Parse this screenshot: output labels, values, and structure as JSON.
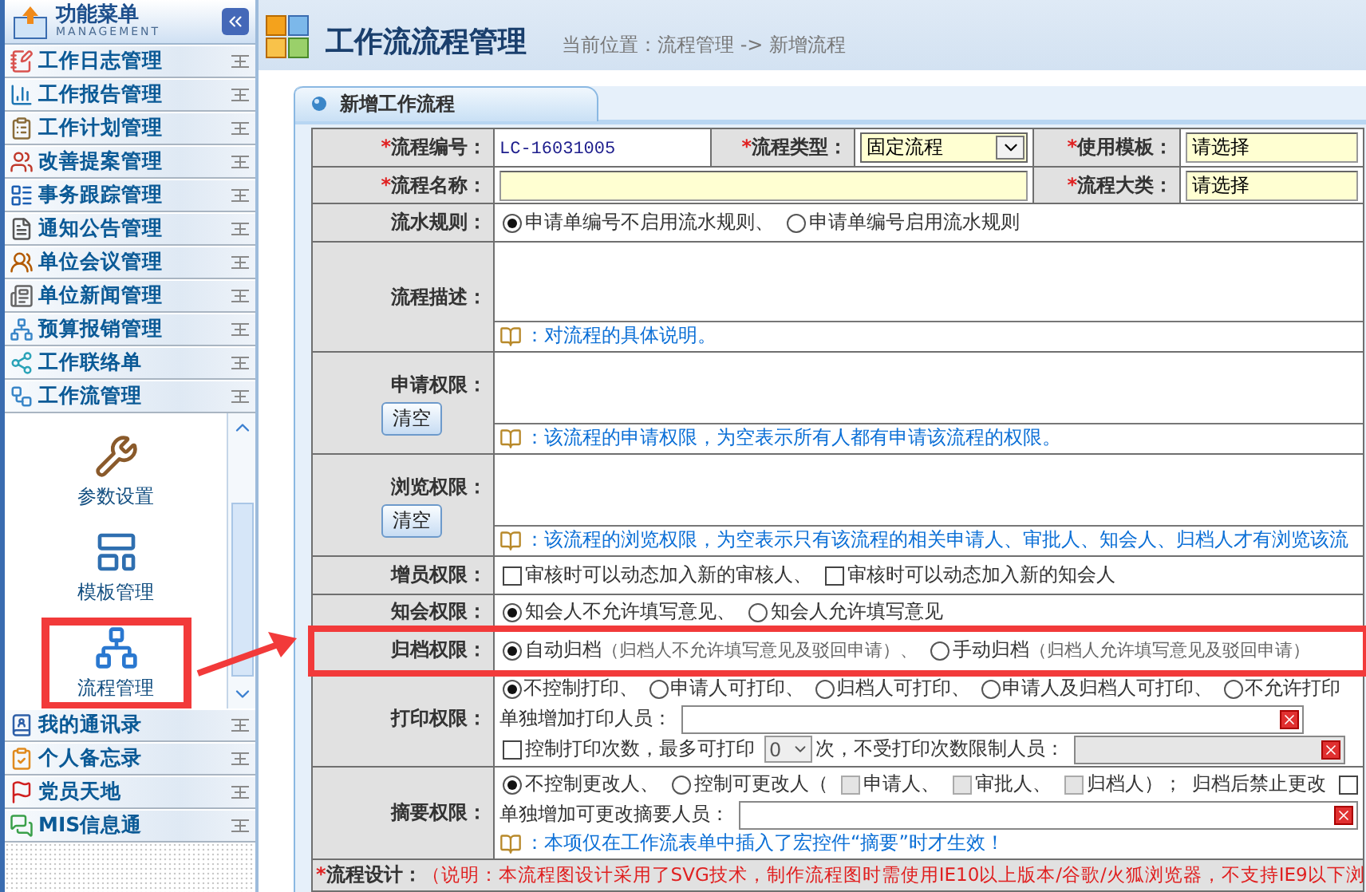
{
  "sidebar": {
    "title": "功能菜单",
    "subtitle": "MANAGEMENT",
    "items": [
      {
        "label": "工作日志管理"
      },
      {
        "label": "工作报告管理"
      },
      {
        "label": "工作计划管理"
      },
      {
        "label": "改善提案管理"
      },
      {
        "label": "事务跟踪管理"
      },
      {
        "label": "通知公告管理"
      },
      {
        "label": "单位会议管理"
      },
      {
        "label": "单位新闻管理"
      },
      {
        "label": "预算报销管理"
      },
      {
        "label": "工作联络单"
      },
      {
        "label": "工作流管理"
      }
    ],
    "submenu": [
      {
        "label": "参数设置",
        "selected": false
      },
      {
        "label": "模板管理",
        "selected": false
      },
      {
        "label": "流程管理",
        "selected": true
      }
    ],
    "bottom_items": [
      {
        "label": "我的通讯录"
      },
      {
        "label": "个人备忘录"
      },
      {
        "label": "党员天地"
      },
      {
        "label": "MIS信息通"
      }
    ]
  },
  "header": {
    "title": "工作流流程管理",
    "breadcrumb": "当前位置：流程管理 -> 新增流程"
  },
  "panel": {
    "title": "新增工作流程"
  },
  "form": {
    "id_row": [
      {
        "label": "流程编号：",
        "required_mark": "*",
        "kind": "text",
        "value": "LC-16031005"
      },
      {
        "label": "流程类型：",
        "required_mark": "*",
        "kind": "select",
        "value": "固定流程"
      },
      {
        "label": "使用模板：",
        "required_mark": "*",
        "kind": "input",
        "value": "请选择"
      }
    ],
    "name_field": {
      "label": "流程名称：",
      "required_mark": "*"
    },
    "category_field": {
      "label": "流程大类：",
      "required_mark": "*",
      "value": "请选择"
    },
    "serial": {
      "label": "流水规则：",
      "options": [
        {
          "label": "申请单编号不启用流水规则、",
          "selected": true
        },
        {
          "label": "申请单编号启用流水规则",
          "selected": false
        }
      ]
    },
    "description": {
      "label": "流程描述：",
      "hint": "：对流程的具体说明。"
    },
    "apply": {
      "label": "申请权限：",
      "button": "清空",
      "hint": "：该流程的申请权限，为空表示所有人都有申请该流程的权限。"
    },
    "browse": {
      "label": "浏览权限：",
      "button": "清空",
      "hint": "：该流程的浏览权限，为空表示只有该流程的相关申请人、审批人、知会人、归档人才有浏览该流"
    },
    "add_members": {
      "label": "增员权限：",
      "options": [
        {
          "label": "审核时可以动态加入新的审核人、",
          "checked": false
        },
        {
          "label": "审核时可以动态加入新的知会人",
          "checked": false
        }
      ]
    },
    "notify": {
      "label": "知会权限：",
      "options": [
        {
          "label": "知会人不允许填写意见、",
          "selected": true
        },
        {
          "label": "知会人允许填写意见",
          "selected": false
        }
      ]
    },
    "archive": {
      "label": "归档权限：",
      "highlighted": true,
      "options": [
        {
          "label": "自动归档",
          "note": "（归档人不允许填写意见及驳回申请）、",
          "selected": true
        },
        {
          "label": "手动归档",
          "note": "（归档人允许填写意见及驳回申请）",
          "selected": false
        }
      ]
    },
    "print": {
      "label": "打印权限：",
      "options": [
        {
          "label": "不控制打印、",
          "selected": true
        },
        {
          "label": "申请人可打印、",
          "selected": false
        },
        {
          "label": "归档人可打印、",
          "selected": false
        },
        {
          "label": "申请人及归档人可打印、",
          "selected": false
        },
        {
          "label": "不允许打印",
          "selected": false
        }
      ],
      "extra_label": "单独增加打印人员：",
      "count_checkbox": {
        "label": "控制打印次数，最多可打印",
        "checked": false
      },
      "count_select": "0",
      "count_suffix": "次，不受打印次数限制人员："
    },
    "summary": {
      "label": "摘要权限：",
      "options": [
        {
          "label": "不控制更改人、",
          "selected": true
        },
        {
          "label": "控制可更改人（",
          "selected": false
        }
      ],
      "roles": [
        {
          "label": "申请人、",
          "checked": false
        },
        {
          "label": "审批人、",
          "checked": false
        },
        {
          "label": "归档人）；",
          "checked": false
        }
      ],
      "lock": {
        "label": "归档后禁止更改",
        "checked": false
      },
      "extra_label": "单独增加可更改摘要人员：",
      "hint": "：本项仅在工作流表单中插入了宏控件“摘要”时才生效！"
    },
    "design": {
      "label": "流程设计：",
      "required_mark": "*",
      "note": "（说明：本流程图设计采用了SVG技术，制作流程图时需使用IE10以上版本/谷歌/火狐浏览器，不支持IE9以下浏"
    }
  }
}
